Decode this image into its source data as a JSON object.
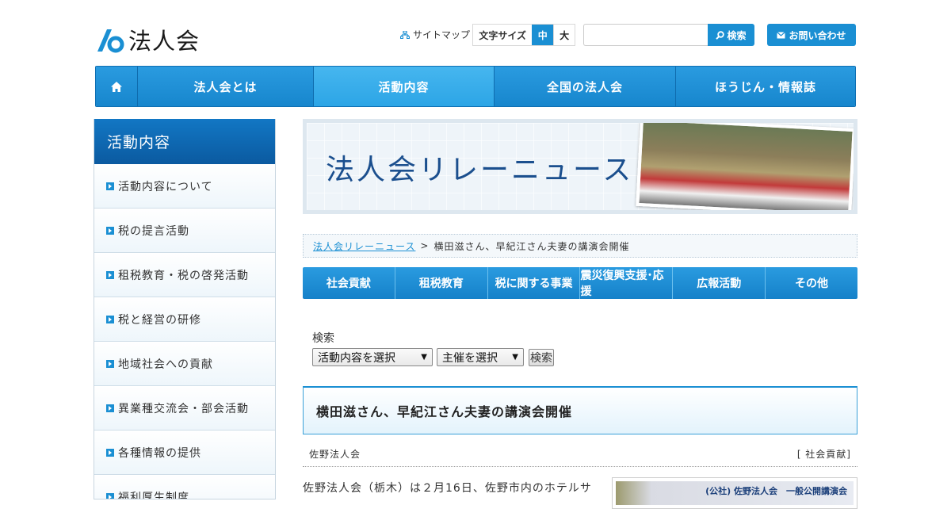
{
  "header": {
    "logo_text": "法人会",
    "sitemap_label": "サイトマップ",
    "fontsize": {
      "label": "文字サイズ",
      "medium": "中",
      "large": "大"
    },
    "search_button": "検索",
    "contact_button": "お問い合わせ",
    "accent_color": "#1a8fd3"
  },
  "global_nav": [
    {
      "label": "法人会とは"
    },
    {
      "label": "活動内容"
    },
    {
      "label": "全国の法人会"
    },
    {
      "label": "ほうじん・情報誌"
    }
  ],
  "sidebar": {
    "title": "活動内容",
    "items": [
      {
        "label": "活動内容について"
      },
      {
        "label": "税の提言活動"
      },
      {
        "label": "租税教育・税の啓発活動"
      },
      {
        "label": "税と経営の研修"
      },
      {
        "label": "地域社会への貢献"
      },
      {
        "label": "異業種交流会・部会活動"
      },
      {
        "label": "各種情報の提供"
      },
      {
        "label": "福利厚生制度"
      }
    ]
  },
  "banner": {
    "title": "法人会リレーニュース"
  },
  "breadcrumb": {
    "link": "法人会リレーニュース",
    "separator": ">",
    "current": "横田滋さん、早紀江さん夫妻の講演会開催"
  },
  "category_nav": [
    {
      "label": "社会貢献"
    },
    {
      "label": "租税教育"
    },
    {
      "label": "税に関する事業"
    },
    {
      "label": "震災復興支援･応援"
    },
    {
      "label": "広報活動"
    },
    {
      "label": "その他"
    }
  ],
  "search": {
    "label": "検索",
    "select_activity": "活動内容を選択",
    "select_organizer": "主催を選択",
    "submit": "検索"
  },
  "article": {
    "title": "横田滋さん、早紀江さん夫妻の講演会開催",
    "organizer": "佐野法人会",
    "category": "[ 社会貢献]",
    "body_first_line": "佐野法人会（栃木）は２月16日、佐野市内のホテルサ",
    "photo_caption": "(公社) 佐野法人会　一般公開講演会"
  }
}
